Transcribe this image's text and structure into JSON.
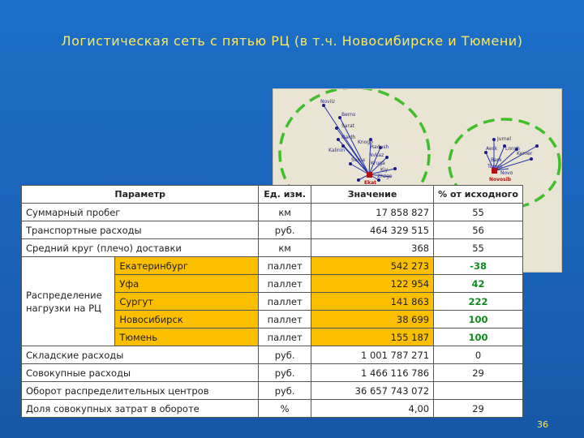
{
  "slide": {
    "title": "Логистическая сеть с пятью РЦ (в т.ч. Новосибирске и Тюмени)",
    "page_number": "36"
  },
  "table": {
    "headers": [
      "Параметр",
      "Ед. изм.",
      "Значение",
      "% от исходного"
    ],
    "rows": [
      {
        "param": "Суммарный пробег",
        "unit": "км",
        "value": "17 858 827",
        "pct": "55"
      },
      {
        "param": "Транспортные расходы",
        "unit": "руб.",
        "value": "464 329 515",
        "pct": "56"
      },
      {
        "param": "Средний круг (плечо) доставки",
        "unit": "км",
        "value": "368",
        "pct": "55"
      }
    ],
    "group_label": "Распределение нагрузки на РЦ",
    "group_rows": [
      {
        "city": "Екатеринбург",
        "unit": "паллет",
        "value": "542 273",
        "pct": "-38"
      },
      {
        "city": "Уфа",
        "unit": "паллет",
        "value": "122 954",
        "pct": "42"
      },
      {
        "city": "Сургут",
        "unit": "паллет",
        "value": "141 863",
        "pct": "222"
      },
      {
        "city": "Новосибирск",
        "unit": "паллет",
        "value": "38 699",
        "pct": "100"
      },
      {
        "city": "Тюмень",
        "unit": "паллет",
        "value": "155 187",
        "pct": "100"
      }
    ],
    "rows_after": [
      {
        "param": "Складские расходы",
        "unit": "руб.",
        "value": "1 001 787 271",
        "pct": "0"
      },
      {
        "param": "Совокупные расходы",
        "unit": "руб.",
        "value": "1 466 116 786",
        "pct": "29"
      },
      {
        "param": "Оборот распределительных центров",
        "unit": "руб.",
        "value": "36 657 743 072",
        "pct": ""
      },
      {
        "param": "Доля совокупных затрат в обороте",
        "unit": "%",
        "value": "4,00",
        "pct": "29"
      }
    ]
  },
  "map": {
    "labels_left": [
      "NoviU",
      "Berns",
      "Sarat",
      "Naidh",
      "Knogo",
      "Kalinin",
      "Radush",
      "Nvkaz",
      "Kruga",
      "Sama",
      "Kiy",
      "Zhzgo",
      "Ekat"
    ],
    "labels_right": [
      "Jurnel",
      "Aesk",
      "Lnnsh",
      "Kemer",
      "Bark",
      "Tomsk",
      "Novo",
      "Novosib"
    ]
  },
  "colors": {
    "title": "#ffe95a",
    "highlight": "#fbbf00",
    "positive_green": "#0e8a1e",
    "circle": "#3fbf2a"
  }
}
